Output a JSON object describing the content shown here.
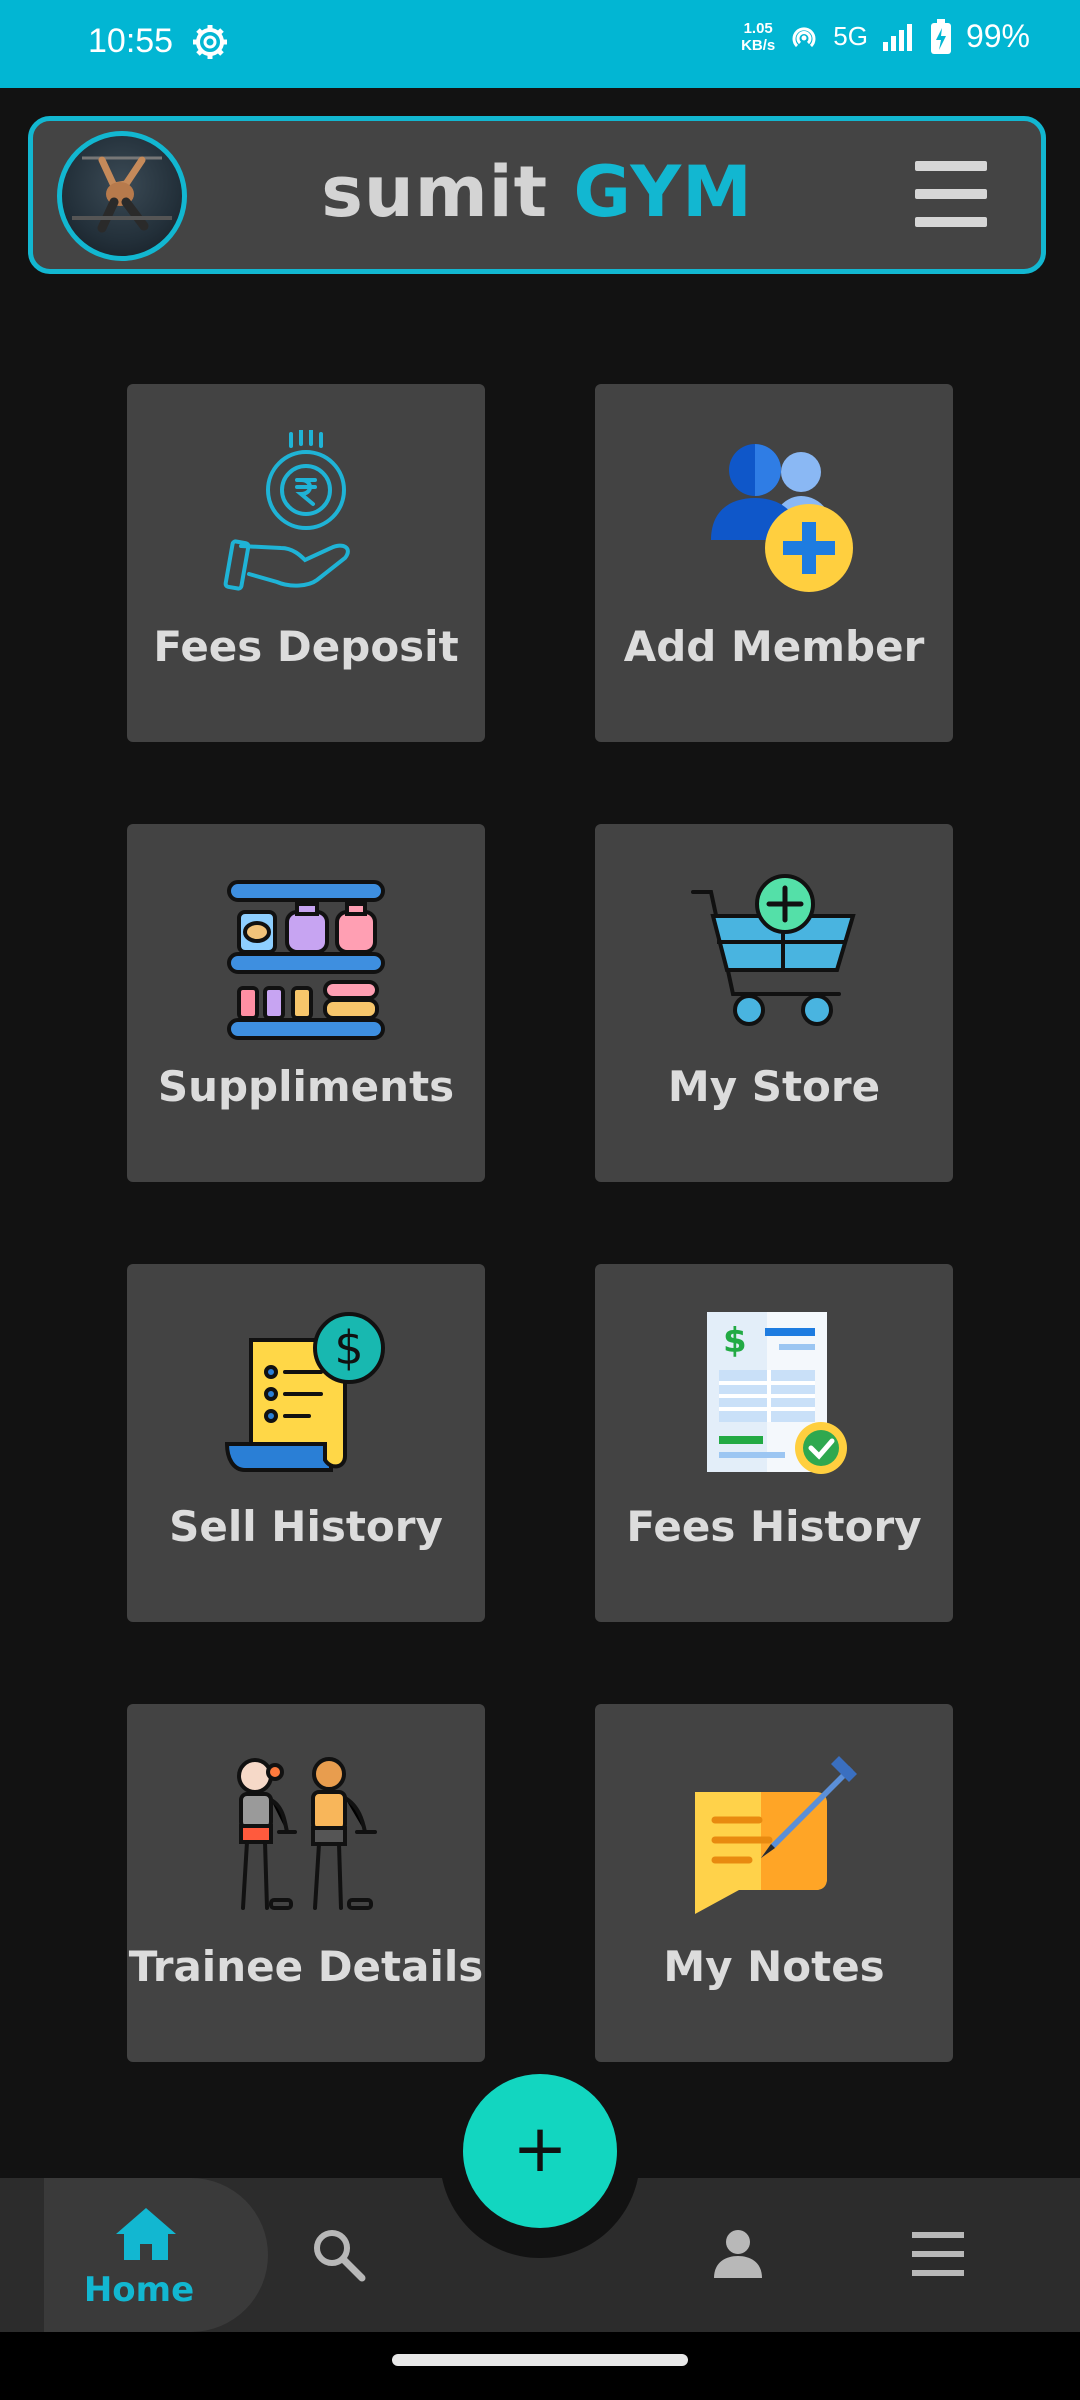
{
  "status_bar": {
    "time": "10:55",
    "net_speed_value": "1.05",
    "net_speed_unit": "KB/s",
    "network": "5G",
    "battery": "99%"
  },
  "header": {
    "title_part1": "sumit",
    "title_part2": "GYM"
  },
  "tiles": [
    {
      "label": "Fees Deposit",
      "icon": "rupee-coin-hand-icon"
    },
    {
      "label": "Add Member",
      "icon": "add-member-icon"
    },
    {
      "label": "Suppliments",
      "icon": "supplement-shelf-icon"
    },
    {
      "label": "My Store",
      "icon": "cart-add-icon"
    },
    {
      "label": "Sell History",
      "icon": "receipt-dollar-icon"
    },
    {
      "label": "Fees History",
      "icon": "invoice-check-icon"
    },
    {
      "label": "Trainee Details",
      "icon": "trainees-icon"
    },
    {
      "label": "My Notes",
      "icon": "notes-pencil-icon"
    }
  ],
  "fab": {
    "label": "+"
  },
  "bottom_nav": {
    "home_label": "Home",
    "items": [
      "home-icon",
      "search-icon",
      "profile-icon",
      "menu-icon"
    ]
  },
  "colors": {
    "accent": "#12b7d1",
    "fab": "#12d6c0",
    "tile": "#434343",
    "background": "#121212"
  }
}
